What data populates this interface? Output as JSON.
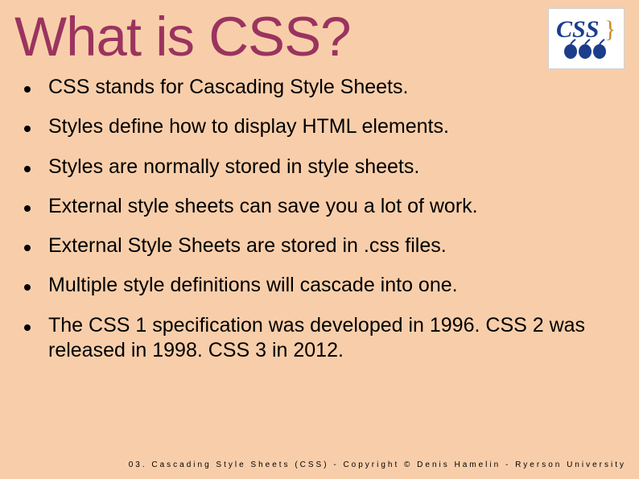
{
  "title": "What is CSS?",
  "logo_text": "CSS",
  "bullets": [
    "CSS stands for Cascading Style Sheets.",
    "Styles define how to display HTML elements.",
    "Styles are normally stored in style sheets.",
    "External style sheets can save you a lot of work.",
    "External Style Sheets are stored in .css files.",
    "Multiple style definitions will cascade into one.",
    "The CSS 1 specification was developed in 1996. CSS 2 was released in 1998. CSS 3 in 2012."
  ],
  "footer": "03. Cascading Style Sheets (CSS) - Copyright © Denis Hamelin - Ryerson University"
}
